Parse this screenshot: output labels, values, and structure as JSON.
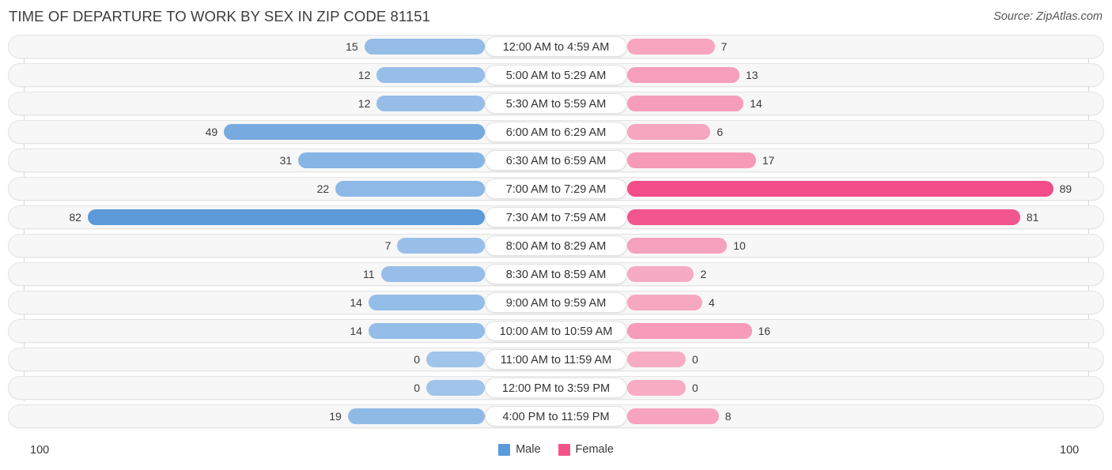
{
  "header": {
    "title": "TIME OF DEPARTURE TO WORK BY SEX IN ZIP CODE 81151",
    "source": "Source: ZipAtlas.com"
  },
  "legend": {
    "male_label": "Male",
    "female_label": "Female",
    "male_color": "#5b9bdc",
    "female_color": "#f4538a"
  },
  "axis": {
    "left_max": "100",
    "right_max": "100"
  },
  "chart_data": {
    "type": "bar",
    "orientation": "horizontal-diverging",
    "title": "TIME OF DEPARTURE TO WORK BY SEX IN ZIP CODE 81151",
    "xlabel": "",
    "ylabel": "",
    "xlim": [
      0,
      100
    ],
    "grid": true,
    "legend_position": "bottom-center",
    "categories": [
      "12:00 AM to 4:59 AM",
      "5:00 AM to 5:29 AM",
      "5:30 AM to 5:59 AM",
      "6:00 AM to 6:29 AM",
      "6:30 AM to 6:59 AM",
      "7:00 AM to 7:29 AM",
      "7:30 AM to 7:59 AM",
      "8:00 AM to 8:29 AM",
      "8:30 AM to 8:59 AM",
      "9:00 AM to 9:59 AM",
      "10:00 AM to 10:59 AM",
      "11:00 AM to 11:59 AM",
      "12:00 PM to 3:59 PM",
      "4:00 PM to 11:59 PM"
    ],
    "series": [
      {
        "name": "Male",
        "color": "#5b9bdc",
        "values": [
          15,
          12,
          12,
          49,
          31,
          22,
          82,
          7,
          11,
          14,
          14,
          0,
          0,
          19
        ]
      },
      {
        "name": "Female",
        "color": "#f4538a",
        "values": [
          7,
          13,
          14,
          6,
          17,
          89,
          81,
          10,
          2,
          4,
          16,
          0,
          0,
          8
        ]
      }
    ]
  }
}
